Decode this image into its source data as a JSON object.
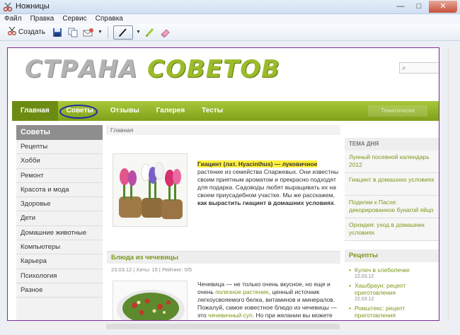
{
  "window": {
    "title": "Ножницы",
    "minimize": "—",
    "maximize": "□",
    "close": "✕"
  },
  "menu": [
    {
      "label": "Файл"
    },
    {
      "label": "Правка"
    },
    {
      "label": "Сервис"
    },
    {
      "label": "Справка"
    }
  ],
  "toolbar": {
    "create_label": "Создать"
  },
  "site": {
    "logo_word1": "СТРАНА",
    "logo_word2": "СОВЕТОВ",
    "nav": [
      {
        "label": "Главная"
      },
      {
        "label": "Советы"
      },
      {
        "label": "Отзывы"
      },
      {
        "label": "Галерея"
      },
      {
        "label": "Тесты"
      }
    ],
    "nav_right_label": "Тематически"
  },
  "sidebar": {
    "title": "Советы",
    "items": [
      "Рецепты",
      "Хобби",
      "Ремонт",
      "Красота и мода",
      "Здоровье",
      "Дети",
      "Домашние животные",
      "Компьютеры",
      "Карьера",
      "Психология",
      "Разное"
    ]
  },
  "main": {
    "breadcrumb": "Главная",
    "article1": {
      "hl": "Гиацинт (лат. Hyacinthus) — луковичное",
      "body": " растение из семейства Спаржевых. Они известны своим приятным ароматом и прекрасно подходят для подарка. Садоводы любят выращивать их на своем приусадебном участке. Мы же расскажем, ",
      "bold": "как вырастить гиацинт в домашних условиях",
      "end": "."
    },
    "article2": {
      "title": "Блюда из чечевицы",
      "meta": "23.03.12 | Хиты: 15 | Рейтинг: 0/5",
      "t1": "Чечевица — не только очень вкусное, но еще и очень ",
      "link1": "полезное растение",
      "t2": ", ценный источник легкоусвояемого белка, витаминов и минералов. Пожалуй, самое известное блюдо из чечевицы — это ",
      "link2": "чечевичный суп",
      "t3": ". Но при желании вы можете готовить салаты"
    }
  },
  "right": {
    "topic_title": "ТЕМА ДНЯ",
    "topics": [
      "Лунный посевной календарь 2012",
      "Гиацинт в домашних условиях",
      "Поделки к Пасхе: декорированное бунагой яйцо",
      "Орхидея: уход в домашних условиях"
    ],
    "recipes_title": "Рецепты",
    "recipes": [
      {
        "title": "Кулич в хлебопечке",
        "date": "22.03.12"
      },
      {
        "title": "Хашбраун: рецепт приготовления",
        "date": "22.03.12"
      },
      {
        "title": "Ромштекс: рецепт приготовления",
        "date": ""
      }
    ]
  },
  "colors": {
    "accent_green": "#8bb022",
    "annotation_blue": "#1f2aa5",
    "snip_border": "#7d2c9b"
  }
}
